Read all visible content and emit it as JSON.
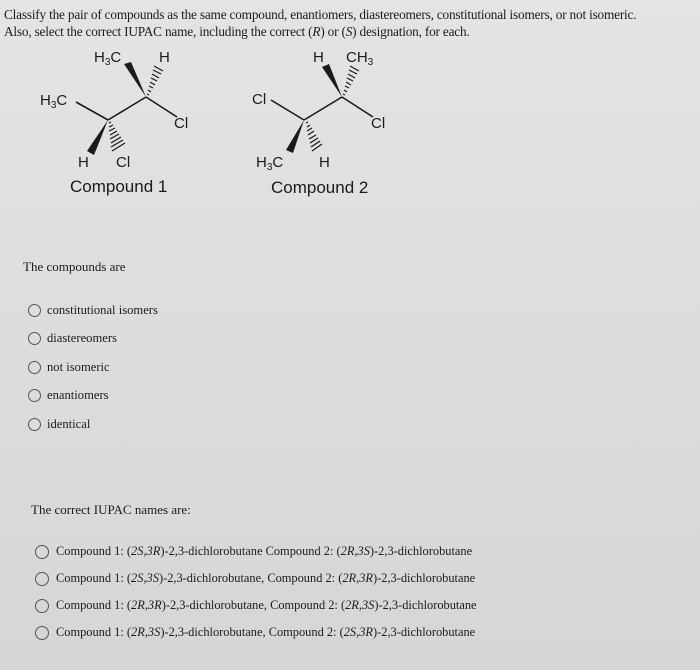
{
  "prompt": {
    "line1": "Classify the pair of compounds as the same compound, enantiomers, diastereomers, constitutional isomers, or not isomeric.",
    "line2": "Also, select the correct IUPAC name, including the correct (R) or (S) designation, for each."
  },
  "compound1": {
    "caption": "Compound 1",
    "labels": {
      "left_methyl": "H3C",
      "top_methyl": "H3C",
      "top_h": "H",
      "right_cl": "Cl",
      "bottom_h": "H",
      "bottom_cl": "Cl"
    }
  },
  "compound2": {
    "caption": "Compound 2",
    "labels": {
      "left_cl": "Cl",
      "top_h": "H",
      "top_methyl": "CH3",
      "right_cl": "Cl",
      "bottom_methyl": "H3C",
      "bottom_h": "H"
    }
  },
  "classification": {
    "label": "The compounds are",
    "options": [
      "constitutional isomers",
      "diastereomers",
      "not isomeric",
      "enantiomers",
      "identical"
    ],
    "selected": null
  },
  "iupac": {
    "label": "The correct IUPAC names are:",
    "options": [
      {
        "c1_prefix": "Compound 1: (",
        "c1_a": "2S",
        "c1_sep": ",",
        "c1_b": "3R",
        "c1_suffix": ")-2,3-dichlorobutane Compound 2: (",
        "c2_a": "2R",
        "c2_sep": ",",
        "c2_b": "3S",
        "c2_suffix": ")-2,3-dichlorobutane"
      },
      {
        "c1_prefix": "Compound 1: (",
        "c1_a": "2S",
        "c1_sep": ",",
        "c1_b": "3S",
        "c1_suffix": ")-2,3-dichlorobutane, Compound 2: (",
        "c2_a": "2R",
        "c2_sep": ",",
        "c2_b": "3R",
        "c2_suffix": ")-2,3-dichlorobutane"
      },
      {
        "c1_prefix": "Compound 1: (",
        "c1_a": "2R",
        "c1_sep": ",",
        "c1_b": "3R",
        "c1_suffix": ")-2,3-dichlorobutane, Compound 2: (",
        "c2_a": "2R",
        "c2_sep": ",",
        "c2_b": "3S",
        "c2_suffix": ")-2,3-dichlorobutane"
      },
      {
        "c1_prefix": "Compound 1: (",
        "c1_a": "2R",
        "c1_sep": ",",
        "c1_b": "3S",
        "c1_suffix": ")-2,3-dichlorobutane, Compound 2: (",
        "c2_a": "2S",
        "c2_sep": ",",
        "c2_b": "3R",
        "c2_suffix": ")-2,3-dichlorobutane"
      }
    ],
    "selected": null
  }
}
